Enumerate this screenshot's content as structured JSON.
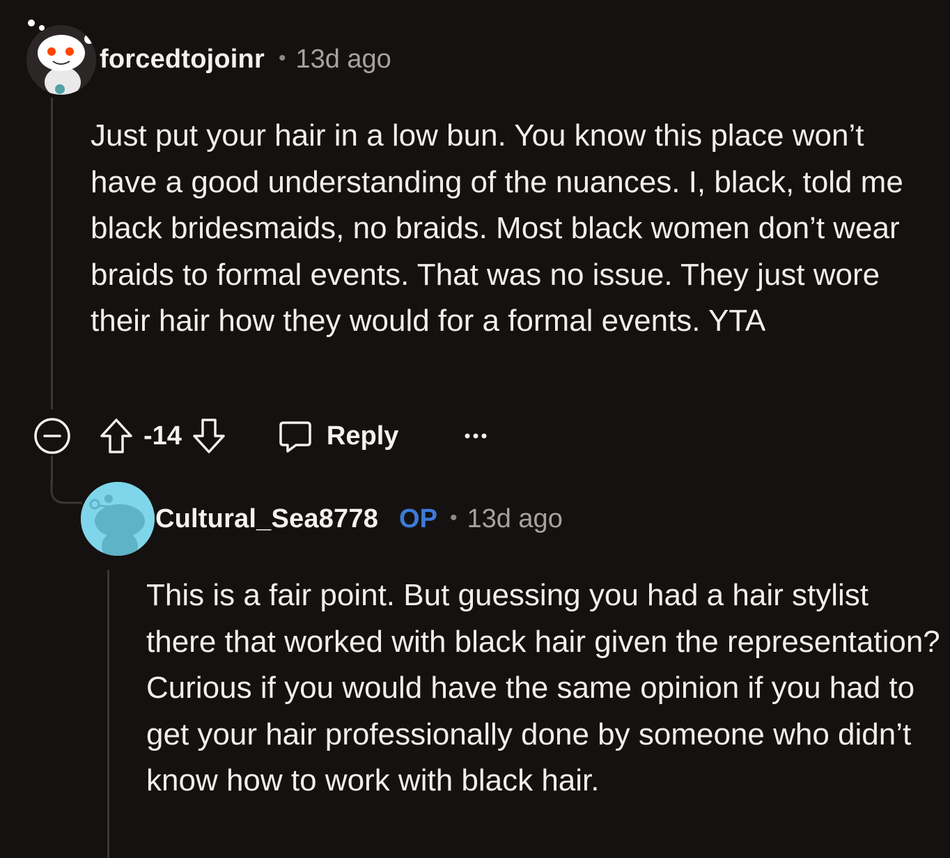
{
  "comments": [
    {
      "username": "forcedtojoinr",
      "separator": "•",
      "age": "13d ago",
      "body": "Just put your hair in a low bun. You know this place won’t have a good understanding of the nuances. I, black, told me black bridesmaids, no braids. Most black women don’t wear braids to formal events. That was no issue. They just wore their hair how they would for a formal events. YTA",
      "score": "-14",
      "reply_label": "Reply",
      "avatar_icon": "snoo-avatar-icon"
    },
    {
      "username": "Cultural_Sea8778",
      "op_badge": "OP",
      "separator": "•",
      "age": "13d ago",
      "body": "This is a fair point. But guessing you had a hair stylist there that worked with black hair given the representation? Curious if you would have the same opinion if you had to get your hair professionally done by someone who didn’t know how to work with black hair.",
      "avatar_icon": "snoo-avatar-icon"
    }
  ],
  "colors": {
    "background": "#151110",
    "op_badge": "#3b7bd9",
    "thread_line": "#3a3634",
    "avatar2_bg": "#7fd6ea"
  },
  "icons": [
    "collapse-icon",
    "upvote-icon",
    "downvote-icon",
    "comment-icon",
    "more-options-icon"
  ]
}
